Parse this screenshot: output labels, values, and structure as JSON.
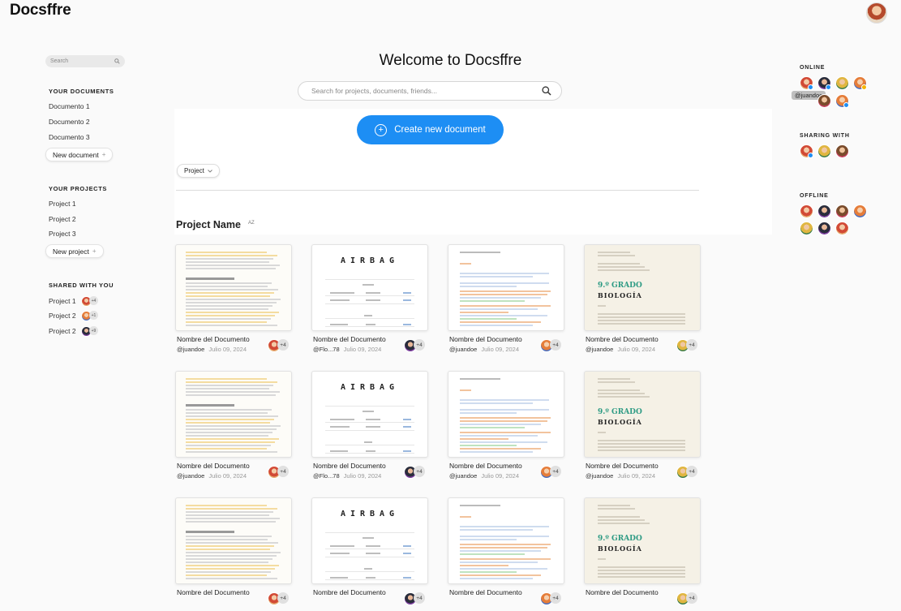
{
  "app": {
    "title": "Docsffre"
  },
  "sidebar": {
    "search_placeholder": "Search",
    "documents_title": "YOUR DOCUMENTS",
    "documents": [
      "Documento 1",
      "Documento 2",
      "Documento 3"
    ],
    "new_document_label": "New document",
    "projects_title": "YOUR PROJECTS",
    "projects": [
      "Project 1",
      "Project 2",
      "Project 3"
    ],
    "new_project_label": "New project",
    "shared_title": "SHARED WITH YOU",
    "shared": [
      {
        "label": "Project 1",
        "count": "+4"
      },
      {
        "label": "Project 2",
        "count": "+1"
      },
      {
        "label": "Project 2",
        "count": "+9"
      }
    ]
  },
  "main": {
    "welcome": "Welcome to Docsffre",
    "search_placeholder": "Search for projects, documents, friends...",
    "create_label": "Create new document",
    "filter_label": "Project",
    "project_title": "Project Name",
    "sort_label": "AZ",
    "cards": [
      {
        "name": "Nombre del Documento",
        "author": "@juandoe",
        "date": "Julio 09, 2024",
        "count": "+4",
        "thumb": "text"
      },
      {
        "name": "Nombre del Documento",
        "author": "@Flo...78",
        "date": "Julio 09, 2024",
        "count": "+4",
        "thumb": "airbag"
      },
      {
        "name": "Nombre del Documento",
        "author": "@juandoe",
        "date": "Julio 09, 2024",
        "count": "+4",
        "thumb": "links"
      },
      {
        "name": "Nombre del Documento",
        "author": "@juandoe",
        "date": "Julio 09, 2024",
        "count": "+4",
        "thumb": "biologia"
      },
      {
        "name": "Nombre del Documento",
        "author": "@juandoe",
        "date": "Julio 09, 2024",
        "count": "+4",
        "thumb": "text"
      },
      {
        "name": "Nombre del Documento",
        "author": "@Flo...78",
        "date": "Julio 09, 2024",
        "count": "+4",
        "thumb": "airbag"
      },
      {
        "name": "Nombre del Documento",
        "author": "@juandoe",
        "date": "Julio 09, 2024",
        "count": "+4",
        "thumb": "links"
      },
      {
        "name": "Nombre del Documento",
        "author": "@juandoe",
        "date": "Julio 09, 2024",
        "count": "+4",
        "thumb": "biologia"
      },
      {
        "name": "Nombre del Documento",
        "author": "",
        "date": "",
        "count": "+4",
        "thumb": "text"
      },
      {
        "name": "Nombre del Documento",
        "author": "",
        "date": "",
        "count": "+4",
        "thumb": "airbag"
      },
      {
        "name": "Nombre del Documento",
        "author": "",
        "date": "",
        "count": "+4",
        "thumb": "links"
      },
      {
        "name": "Nombre del Documento",
        "author": "",
        "date": "",
        "count": "+4",
        "thumb": "biologia"
      }
    ],
    "thumb_text": {
      "airbag": "AIRBAG",
      "grado": "9.º GRADO",
      "biologia": "BIOLOGÍA"
    }
  },
  "right_panel": {
    "online_title": "ONLINE",
    "online_tooltip": "@juandoe",
    "sharing_title": "SHARING WITH",
    "offline_title": "OFFLINE"
  },
  "icons": {
    "search": "search-icon",
    "plus": "plus-icon",
    "chevron": "chevron-down-icon",
    "sort": "sort-az-icon",
    "avatar": "avatar-icon"
  },
  "colors": {
    "accent": "#1d8ef4",
    "highlight": "#f4dca0",
    "biology_green": "#2e9b84"
  }
}
